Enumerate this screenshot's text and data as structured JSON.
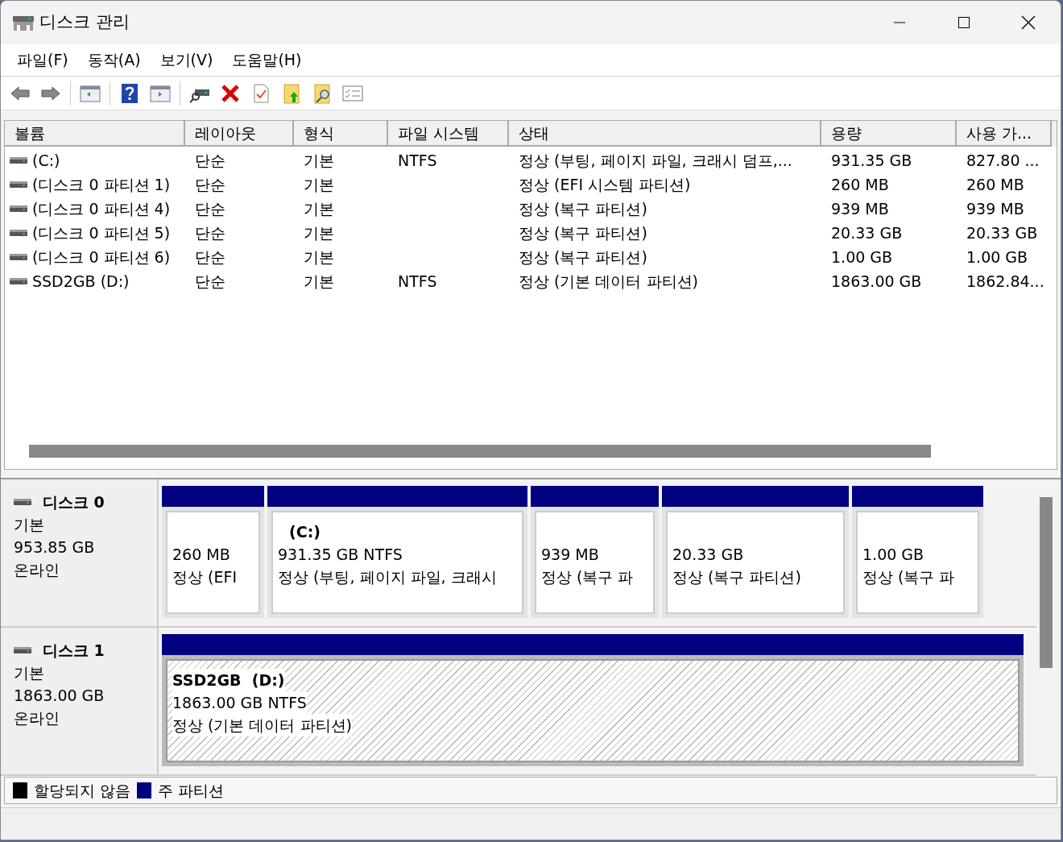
{
  "window": {
    "title": "디스크 관리"
  },
  "menu": [
    "파일(F)",
    "동작(A)",
    "보기(V)",
    "도움말(H)"
  ],
  "table": {
    "columns": [
      "볼륨",
      "레이아웃",
      "형식",
      "파일 시스템",
      "상태",
      "용량",
      "사용 가..."
    ],
    "rows": [
      {
        "cells": [
          "(C:)",
          "단순",
          "기본",
          "NTFS",
          "정상 (부팅, 페이지 파일, 크래시 덤프,...",
          "931.35 GB",
          "827.80 ..."
        ]
      },
      {
        "cells": [
          "(디스크 0 파티션 1)",
          "단순",
          "기본",
          "",
          "정상 (EFI 시스템 파티션)",
          "260 MB",
          "260 MB"
        ]
      },
      {
        "cells": [
          "(디스크 0 파티션 4)",
          "단순",
          "기본",
          "",
          "정상 (복구 파티션)",
          "939 MB",
          "939 MB"
        ]
      },
      {
        "cells": [
          "(디스크 0 파티션 5)",
          "단순",
          "기본",
          "",
          "정상 (복구 파티션)",
          "20.33 GB",
          "20.33 GB"
        ]
      },
      {
        "cells": [
          "(디스크 0 파티션 6)",
          "단순",
          "기본",
          "",
          "정상 (복구 파티션)",
          "1.00 GB",
          "1.00 GB"
        ]
      },
      {
        "cells": [
          "SSD2GB (D:)",
          "단순",
          "기본",
          "NTFS",
          "정상 (기본 데이터 파티션)",
          "1863.00 GB",
          "1862.84..."
        ]
      }
    ]
  },
  "disks": [
    {
      "name": "디스크 0",
      "type": "기본",
      "size": "953.85 GB",
      "status": "온라인",
      "partitions": [
        {
          "size": "260 MB",
          "status": "정상 (EFI",
          "selected": false
        },
        {
          "label": "(C:)",
          "size": "931.35 GB NTFS",
          "status": "정상 (부팅, 페이지 파일, 크래시",
          "selected": false
        },
        {
          "size": "939 MB",
          "status": "정상 (복구 파",
          "selected": false
        },
        {
          "size": "20.33 GB",
          "status": "정상 (복구 파티션)",
          "selected": false
        },
        {
          "size": "1.00 GB",
          "status": "정상 (복구 파",
          "selected": false
        }
      ]
    },
    {
      "name": "디스크 1",
      "type": "기본",
      "size": "1863.00 GB",
      "status": "온라인",
      "partitions": [
        {
          "label": "SSD2GB  (D:)",
          "size": "1863.00 GB NTFS",
          "status": "정상 (기본 데이터 파티션)",
          "selected": true
        }
      ]
    }
  ],
  "legend": [
    {
      "label": "할당되지 않음",
      "color": "#000000"
    },
    {
      "label": "주 파티션",
      "color": "#000080"
    }
  ]
}
